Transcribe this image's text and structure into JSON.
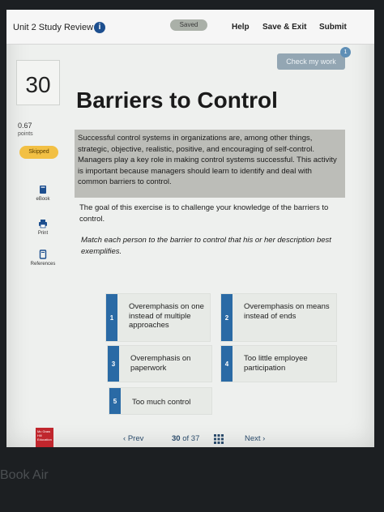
{
  "header": {
    "assignment_title": "Unit 2 Study Review",
    "info_icon": "i",
    "saved_label": "Saved",
    "help_label": "Help",
    "save_exit_label": "Save & Exit",
    "submit_label": "Submit"
  },
  "check_work": {
    "label": "Check my work",
    "badge_count": "1"
  },
  "question": {
    "number": "30",
    "points_value": "0.67",
    "points_label": "points",
    "status": "Skipped"
  },
  "tools": [
    {
      "label": "eBook",
      "icon": "book-icon"
    },
    {
      "label": "Print",
      "icon": "printer-icon"
    },
    {
      "label": "References",
      "icon": "document-icon"
    }
  ],
  "content": {
    "title": "Barriers to Control",
    "intro": "Successful control systems in organizations are, among other things, strategic, objective, realistic, positive, and encouraging of self-control. Managers play a key role in making control systems successful. This activity is important because managers should learn to identify and deal with common barriers to control.",
    "goal": "The goal of this exercise is to challenge your knowledge of the barriers to control.",
    "instruction": "Match each person to the barrier to control that his or her description best exemplifies."
  },
  "cards": [
    {
      "num": "1",
      "text": "Overemphasis on one instead of multiple approaches"
    },
    {
      "num": "2",
      "text": "Overemphasis on means instead of ends"
    },
    {
      "num": "3",
      "text": "Overemphasis on paperwork"
    },
    {
      "num": "4",
      "text": "Too little employee participation"
    },
    {
      "num": "5",
      "text": "Too much control"
    }
  ],
  "pagination": {
    "prev_label": "Prev",
    "current": "30",
    "of_label": "of",
    "total": "37",
    "next_label": "Next"
  },
  "brand": {
    "publisher_logo": "Mc Graw Hill Education",
    "device": "Book Air"
  },
  "colors": {
    "accent_blue": "#2a6aa5",
    "skipped_yellow": "#f2c044",
    "info_blue": "#1d4f8f"
  }
}
